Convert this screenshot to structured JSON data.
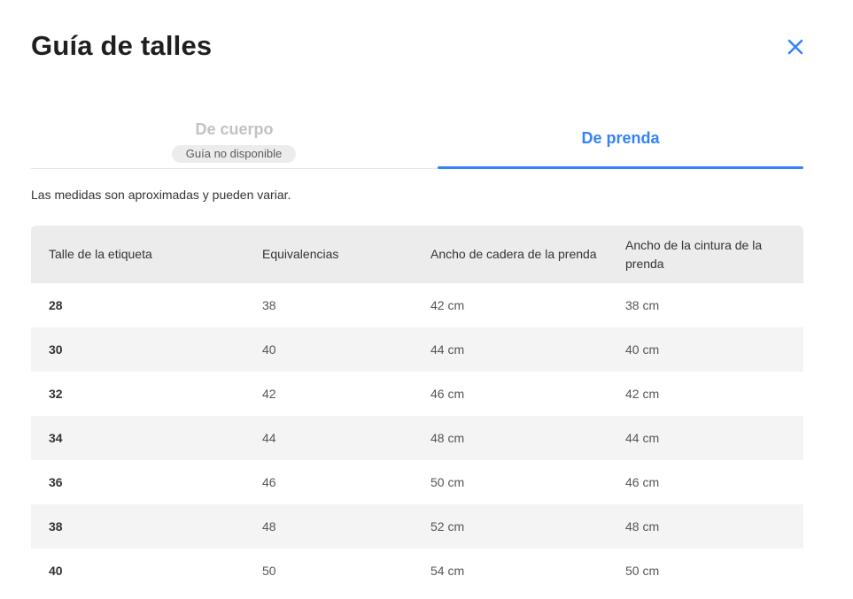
{
  "title": "Guía de talles",
  "colors": {
    "accent": "#3483fa",
    "title": "#1f1f1f",
    "muted": "#c2c2c2",
    "stripe": "#f4f4f4",
    "header_bg": "#ececec"
  },
  "close_icon": "close-icon",
  "tabs": [
    {
      "label": "De cuerpo",
      "badge": "Guía no disponible",
      "selected": false
    },
    {
      "label": "De prenda",
      "selected": true
    }
  ],
  "note": "Las medidas son aproximadas y pueden variar.",
  "table": {
    "headers": [
      "Talle de la etiqueta",
      "Equivalencias",
      "Ancho de cadera de la prenda",
      "Ancho de la cintura de la prenda"
    ],
    "rows": [
      [
        "28",
        "38",
        "42 cm",
        "38 cm"
      ],
      [
        "30",
        "40",
        "44 cm",
        "40 cm"
      ],
      [
        "32",
        "42",
        "46 cm",
        "42 cm"
      ],
      [
        "34",
        "44",
        "48 cm",
        "44 cm"
      ],
      [
        "36",
        "46",
        "50 cm",
        "46 cm"
      ],
      [
        "38",
        "48",
        "52 cm",
        "48 cm"
      ],
      [
        "40",
        "50",
        "54 cm",
        "50 cm"
      ]
    ]
  }
}
